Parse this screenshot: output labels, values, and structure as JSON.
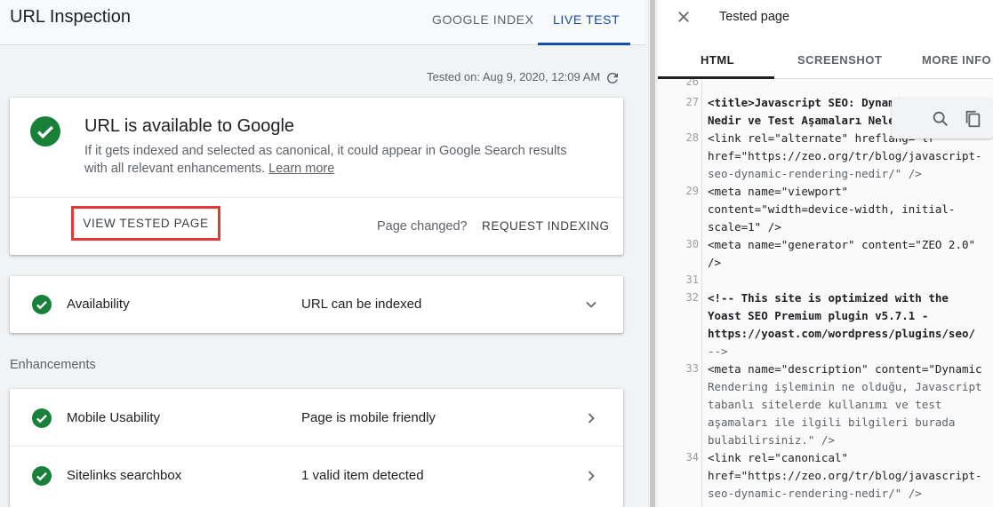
{
  "header": {
    "title": "URL Inspection",
    "tabs": [
      {
        "label": "GOOGLE INDEX"
      },
      {
        "label": "LIVE TEST"
      }
    ]
  },
  "tested_on": "Tested on: Aug 9, 2020, 12:09 AM",
  "main_card": {
    "title": "URL is available to Google",
    "description": "If it gets indexed and selected as canonical, it could appear in Google Search results with all relevant enhancements.",
    "learn_more": "Learn more",
    "view_button": "VIEW TESTED PAGE",
    "page_changed": "Page changed?",
    "request_button": "REQUEST INDEXING"
  },
  "availability": {
    "label": "Availability",
    "value": "URL can be indexed"
  },
  "enhancements": {
    "title": "Enhancements",
    "rows": [
      {
        "label": "Mobile Usability",
        "value": "Page is mobile friendly"
      },
      {
        "label": "Sitelinks searchbox",
        "value": "1 valid item detected"
      }
    ]
  },
  "panel": {
    "title": "Tested page",
    "tabs": [
      {
        "label": "HTML"
      },
      {
        "label": "SCREENSHOT"
      },
      {
        "label": "MORE INFO"
      }
    ],
    "line_numbers": [
      "26",
      "27",
      "28",
      "29",
      "30",
      "31",
      "32",
      "33",
      "34"
    ],
    "code_text": {
      "l27a_tag": "<title>",
      "l27a_rest": "Javascript SEO: Dynamic",
      "l27b": "Nedir ve Test Aşamaları Nelerd",
      "l28a": "<link rel=\"alternate\" hreflang=\"tr\"",
      "l28b": "href=\"https://zeo.org/tr/blog/javascript-",
      "l28c": "seo-dynamic-rendering-nedir/\" />",
      "l29a": "<meta name=\"viewport\"",
      "l29b": "content=\"width=device-width, initial-",
      "l29c": "scale=1\" />",
      "l30a": "<meta name=\"generator\" content=\"ZEO 2.0\"",
      "l30b": "/>",
      "l32a": "<!-- This site is optimized with the",
      "l32b": "Yoast SEO Premium plugin v5.7.1 -",
      "l32c": "https://yoast.com/wordpress/plugins/seo/",
      "l32d": "-->",
      "l33a": "<meta name=\"description\" content=\"Dynamic",
      "l33b": "Rendering işleminin ne olduğu, Javascript",
      "l33c": "tabanlı sitelerde kullanımı ve test",
      "l33d": "aşamaları ile ilgili bilgileri burada",
      "l33e": "bulabilirsiniz.\" />",
      "l34a": "<link rel=\"canonical\"",
      "l34b": "href=\"https://zeo.org/tr/blog/javascript-",
      "l34c": "seo-dynamic-rendering-nedir/\" />"
    }
  },
  "colors": {
    "accent": "#174ea6",
    "success": "#188038",
    "highlight_border": "#e53935"
  },
  "icons": [
    "refresh-icon",
    "check-circle-icon",
    "chevron-down-icon",
    "chevron-right-icon",
    "close-icon",
    "search-icon",
    "copy-icon"
  ]
}
